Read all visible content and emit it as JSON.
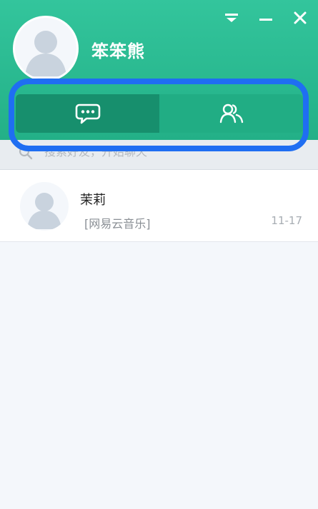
{
  "header": {
    "username": "笨笨熊",
    "accent": "#2bbd94",
    "icons": [
      "dropdown-icon",
      "minimize-icon",
      "close-icon"
    ]
  },
  "tabs": [
    {
      "icon": "chat-bubble-icon",
      "active": true
    },
    {
      "icon": "contacts-icon",
      "active": false
    }
  ],
  "highlight_color": "#1f6ef2",
  "search": {
    "placeholder": "搜索好友，开始聊天"
  },
  "chats": [
    {
      "name": "茉莉",
      "last_message": "[网易云音乐]",
      "time": "11-17"
    }
  ]
}
